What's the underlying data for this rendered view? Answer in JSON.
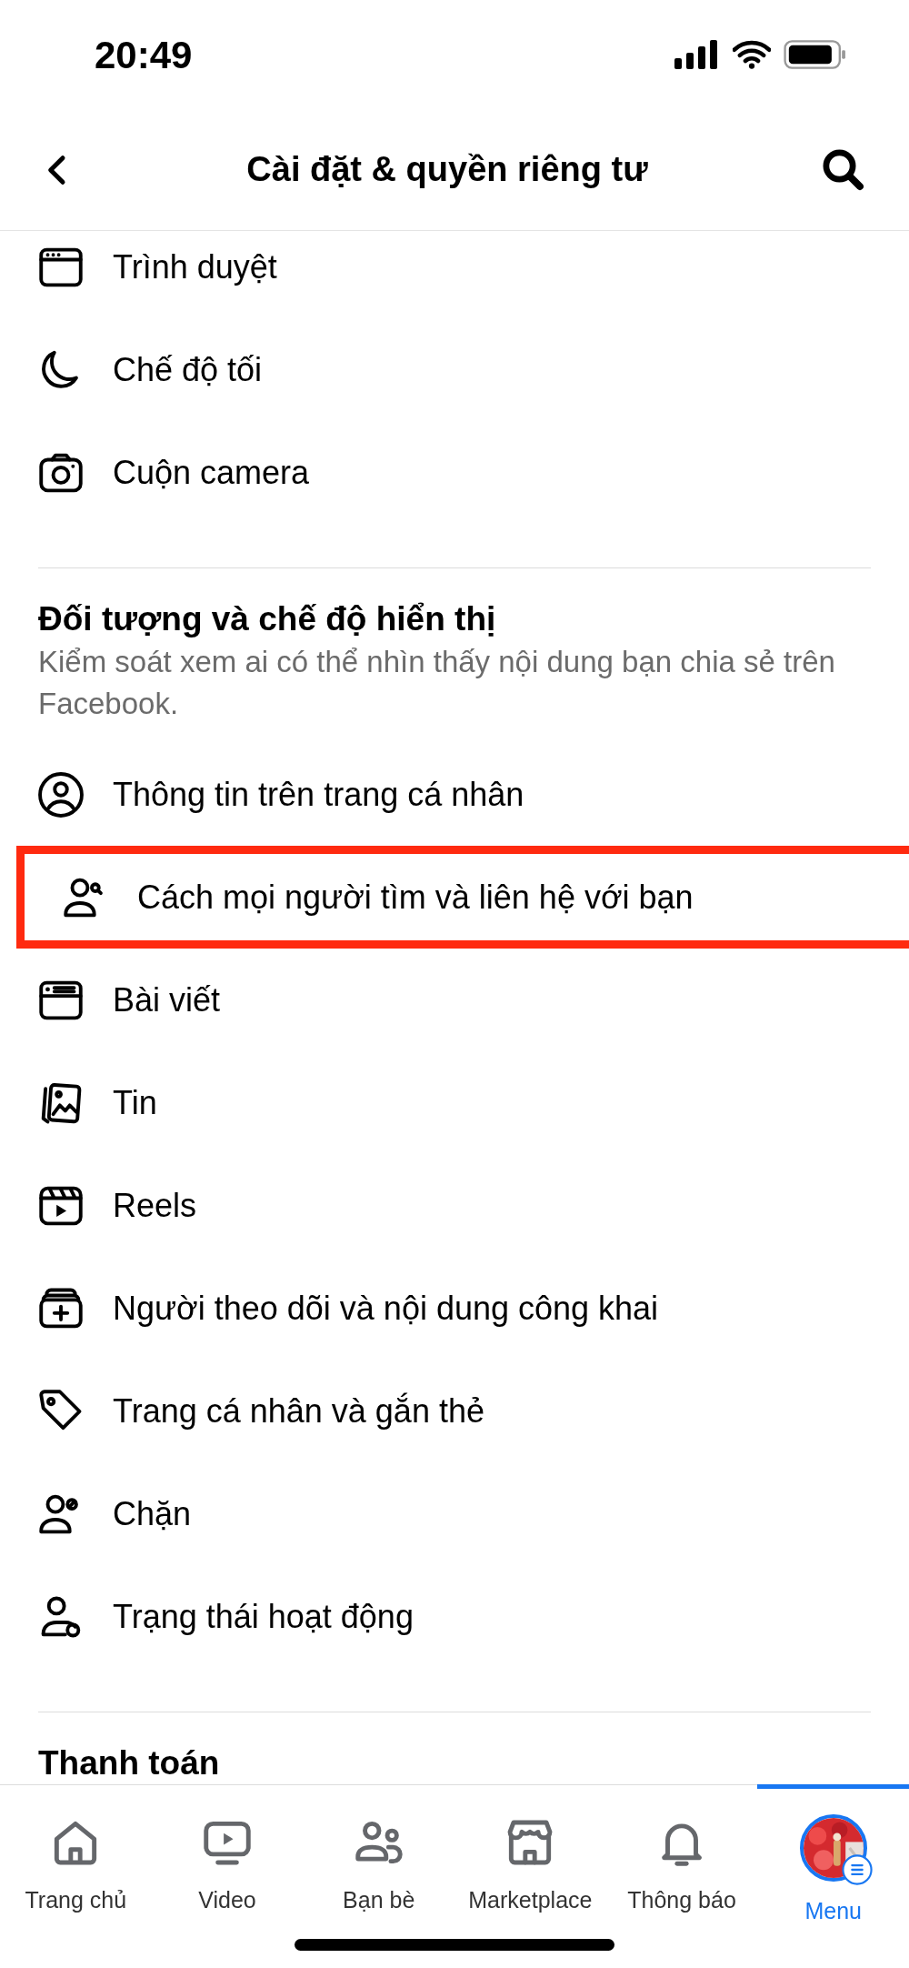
{
  "status_bar": {
    "time": "20:49"
  },
  "header": {
    "title": "Cài đặt & quyền riêng tư"
  },
  "sections": [
    {
      "items": [
        {
          "label": "Trình duyệt",
          "highlighted": false
        },
        {
          "label": "Chế độ tối",
          "highlighted": false
        },
        {
          "label": "Cuộn camera",
          "highlighted": false
        }
      ]
    },
    {
      "title": "Đối tượng và chế độ hiển thị",
      "description": "Kiểm soát xem ai có thể nhìn thấy nội dung bạn chia sẻ trên Facebook.",
      "items": [
        {
          "label": "Thông tin trên trang cá nhân",
          "highlighted": false
        },
        {
          "label": "Cách mọi người tìm và liên hệ với bạn",
          "highlighted": true
        },
        {
          "label": "Bài viết",
          "highlighted": false
        },
        {
          "label": "Tin",
          "highlighted": false
        },
        {
          "label": "Reels",
          "highlighted": false
        },
        {
          "label": "Người theo dõi và nội dung công khai",
          "highlighted": false
        },
        {
          "label": "Trang cá nhân và gắn thẻ",
          "highlighted": false
        },
        {
          "label": "Chặn",
          "highlighted": false
        },
        {
          "label": "Trạng thái hoạt động",
          "highlighted": false
        }
      ]
    },
    {
      "title": "Thanh toán"
    }
  ],
  "tab_bar": [
    {
      "label": "Trang chủ",
      "selected": false
    },
    {
      "label": "Video",
      "selected": false
    },
    {
      "label": "Bạn bè",
      "selected": false
    },
    {
      "label": "Marketplace",
      "selected": false
    },
    {
      "label": "Thông báo",
      "selected": false
    },
    {
      "label": "Menu",
      "selected": true
    }
  ]
}
